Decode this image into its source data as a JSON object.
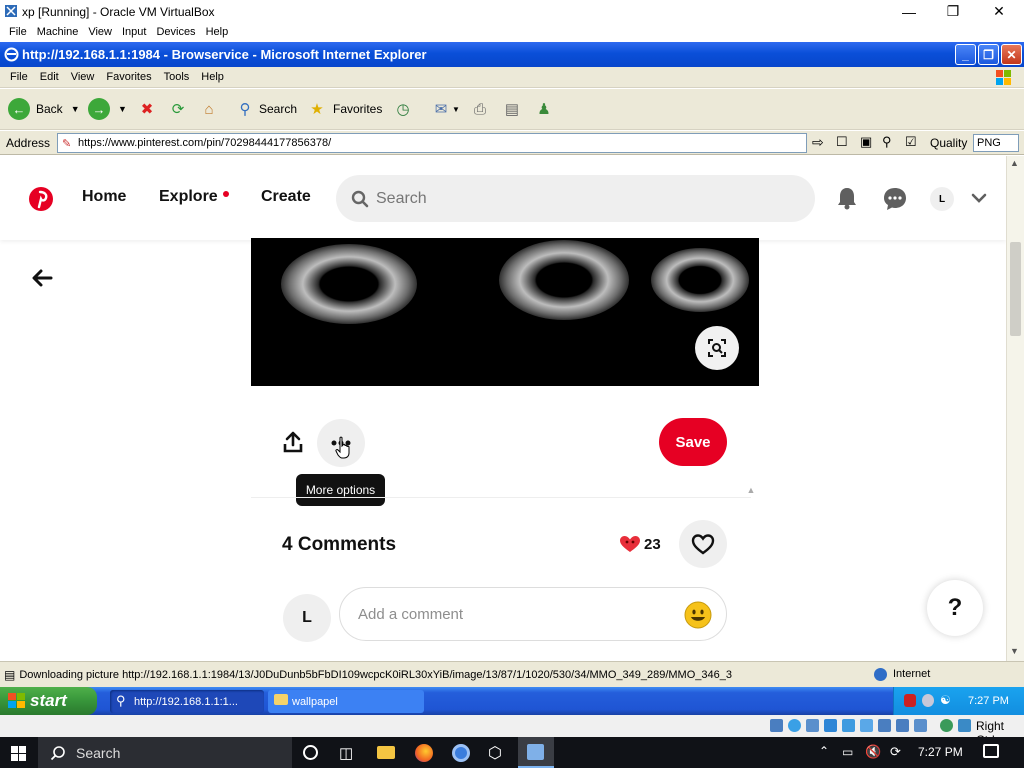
{
  "vbox": {
    "title": "xp [Running] - Oracle VM VirtualBox",
    "menu": [
      "File",
      "Machine",
      "View",
      "Input",
      "Devices",
      "Help"
    ],
    "status_right": "Right Ctrl"
  },
  "ie": {
    "title": "http://192.168.1.1:1984 - Browservice - Microsoft Internet Explorer",
    "menu": [
      "File",
      "Edit",
      "View",
      "Favorites",
      "Tools",
      "Help"
    ],
    "toolbar": {
      "back": "Back",
      "search": "Search",
      "favorites": "Favorites"
    },
    "address_label": "Address",
    "address_url": "https://www.pinterest.com/pin/70298444177856378/",
    "quality_label": "Quality",
    "quality_value": "PNG",
    "status_text": "Downloading picture http://192.168.1.1:1984/13/J0DuDunb5bFbDI109wcpcK0iRL30xYiB/image/13/87/1/1020/530/34/MMO_349_289/MMO_346_3",
    "status_zone": "Internet"
  },
  "pinterest": {
    "nav": {
      "home": "Home",
      "explore": "Explore",
      "create": "Create"
    },
    "search_placeholder": "Search",
    "avatar_letter": "L",
    "save_label": "Save",
    "tooltip": "More options",
    "comments_title": "4 Comments",
    "reaction_count": "23",
    "comment_avatar": "L",
    "comment_placeholder": "Add a comment",
    "help_label": "?",
    "colors": {
      "brand_red": "#e60023"
    }
  },
  "xp_taskbar": {
    "start_label": "start",
    "tasks": [
      "http://192.168.1.1:1...",
      "wallpapel"
    ],
    "clock": "7:27 PM"
  },
  "win_taskbar": {
    "search_label": "Search",
    "clock": "7:27 PM"
  }
}
